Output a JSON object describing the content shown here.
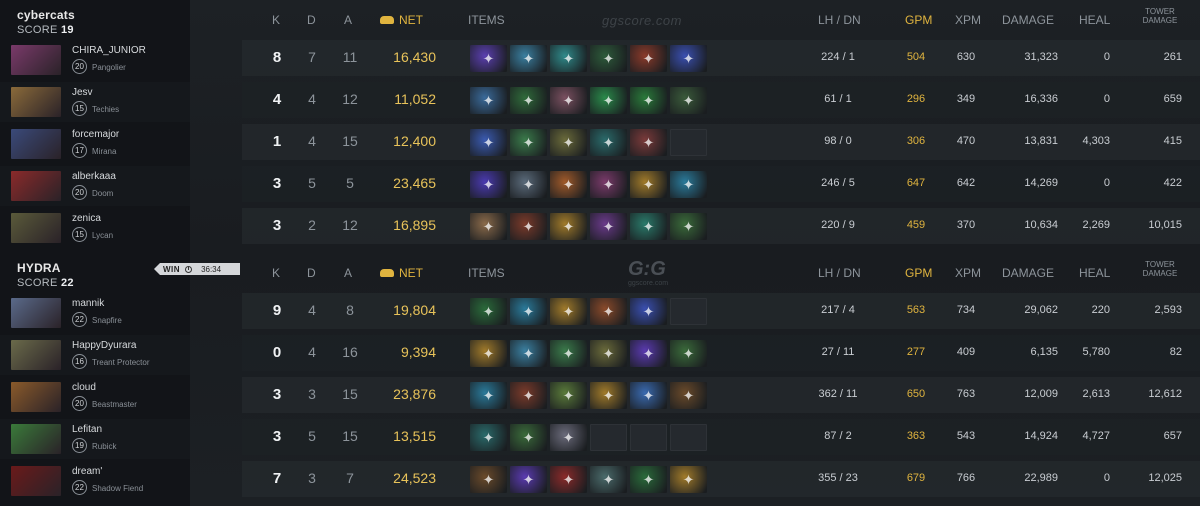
{
  "headers": {
    "k": "K",
    "d": "D",
    "a": "A",
    "net": "NET",
    "items": "ITEMS",
    "lh_dn": "LH / DN",
    "gpm": "GPM",
    "xpm": "XPM",
    "damage": "DAMAGE",
    "heal": "HEAL",
    "tower_damage_1": "TOWER",
    "tower_damage_2": "DAMAGE"
  },
  "watermark_top": "ggscore.com",
  "watermark_mid": "G:G",
  "watermark_mid_sub": "ggscore.com",
  "colors": {
    "gold": "#e0b43f",
    "background": "#16191d"
  },
  "teams": [
    {
      "name": "cybercats",
      "score_label": "SCORE",
      "score": "19",
      "players": [
        {
          "name": "CHIRA_JUNIOR",
          "level": "20",
          "hero": "Pangolier",
          "k": "8",
          "d": "7",
          "a": "11",
          "net": "16,430",
          "items": [
            "#5b3fb0",
            "#3a7fa0",
            "#2f8a8a",
            "#2d5a3a",
            "#8a3a2a",
            "#3a4fb0"
          ],
          "lh_dn": "224 / 1",
          "gpm": "504",
          "xpm": "630",
          "damage": "31,323",
          "heal": "0",
          "tower": "261",
          "avatar": "#7a3a6a"
        },
        {
          "name": "Jesv",
          "level": "15",
          "hero": "Techies",
          "k": "4",
          "d": "4",
          "a": "12",
          "net": "11,052",
          "items": [
            "#3a6a9a",
            "#2f6a3a",
            "#7a5060",
            "#2a8a4a",
            "#2a7a3a",
            "#3a5a3a"
          ],
          "lh_dn": "61 / 1",
          "gpm": "296",
          "xpm": "349",
          "damage": "16,336",
          "heal": "0",
          "tower": "659",
          "avatar": "#8a6a3a"
        },
        {
          "name": "forcemajor",
          "level": "17",
          "hero": "Mirana",
          "k": "1",
          "d": "4",
          "a": "15",
          "net": "12,400",
          "items": [
            "#3a5ab0",
            "#3a7a4a",
            "#6a6a3a",
            "#2a6a6a",
            "#7a3a3a",
            ""
          ],
          "lh_dn": "98 / 0",
          "gpm": "306",
          "xpm": "470",
          "damage": "13,831",
          "heal": "4,303",
          "tower": "415",
          "avatar": "#3a4a7a"
        },
        {
          "name": "alberkaaa",
          "level": "20",
          "hero": "Doom",
          "k": "3",
          "d": "5",
          "a": "5",
          "net": "23,465",
          "items": [
            "#4a3ab0",
            "#5a6a7a",
            "#a05a2a",
            "#7a3a6a",
            "#a07a2a",
            "#2a7a9a"
          ],
          "lh_dn": "246 / 5",
          "gpm": "647",
          "xpm": "642",
          "damage": "14,269",
          "heal": "0",
          "tower": "422",
          "avatar": "#8a2a2a"
        },
        {
          "name": "zenica",
          "level": "15",
          "hero": "Lycan",
          "k": "3",
          "d": "2",
          "a": "12",
          "net": "16,895",
          "items": [
            "#8a6a4a",
            "#7a3a2a",
            "#a07a2a",
            "#6a3a8a",
            "#2a7a6a",
            "#3a6a3a"
          ],
          "lh_dn": "220 / 9",
          "gpm": "459",
          "xpm": "370",
          "damage": "10,634",
          "heal": "2,269",
          "tower": "10,015",
          "avatar": "#5a5a3a"
        }
      ]
    },
    {
      "name": "HYDRA",
      "score_label": "SCORE",
      "score": "22",
      "result": "WIN",
      "duration": "36:34",
      "players": [
        {
          "name": "mannik",
          "level": "22",
          "hero": "Snapfire",
          "k": "9",
          "d": "4",
          "a": "8",
          "net": "19,804",
          "items": [
            "#2a6a3a",
            "#2a7a9a",
            "#a07a2a",
            "#8a4a2a",
            "#3a4fb0",
            ""
          ],
          "lh_dn": "217 / 4",
          "gpm": "563",
          "xpm": "734",
          "damage": "29,062",
          "heal": "220",
          "tower": "2,593",
          "avatar": "#5a6a8a"
        },
        {
          "name": "HappyDyurara",
          "level": "16",
          "hero": "Treant Protector",
          "k": "0",
          "d": "4",
          "a": "16",
          "net": "9,394",
          "items": [
            "#a07a2a",
            "#3a7fa0",
            "#3a7a4a",
            "#6a6a3a",
            "#5a3ab0",
            "#3a6a3a"
          ],
          "lh_dn": "27 / 11",
          "gpm": "277",
          "xpm": "409",
          "damage": "6,135",
          "heal": "5,780",
          "tower": "82",
          "avatar": "#6a6a4a"
        },
        {
          "name": "cloud",
          "level": "20",
          "hero": "Beastmaster",
          "k": "3",
          "d": "3",
          "a": "15",
          "net": "23,876",
          "items": [
            "#2a7a9a",
            "#7a3a2a",
            "#5a7a3a",
            "#a07a2a",
            "#3a6ab0",
            "#6a4a2a"
          ],
          "lh_dn": "362 / 11",
          "gpm": "650",
          "xpm": "763",
          "damage": "12,009",
          "heal": "2,613",
          "tower": "12,612",
          "avatar": "#8a5a2a"
        },
        {
          "name": "Lefitan",
          "level": "19",
          "hero": "Rubick",
          "k": "3",
          "d": "5",
          "a": "15",
          "net": "13,515",
          "items": [
            "#2a6a6a",
            "#3a6a3a",
            "#6a6a7a",
            "",
            "",
            ""
          ],
          "lh_dn": "87 / 2",
          "gpm": "363",
          "xpm": "543",
          "damage": "14,924",
          "heal": "4,727",
          "tower": "657",
          "avatar": "#3a7a3a"
        },
        {
          "name": "dream'",
          "level": "22",
          "hero": "Shadow Fiend",
          "k": "7",
          "d": "3",
          "a": "7",
          "net": "24,523",
          "items": [
            "#6a4a2a",
            "#5a3ab0",
            "#8a2a2a",
            "#4a6a6a",
            "#2a6a3a",
            "#a07a2a"
          ],
          "lh_dn": "355 / 23",
          "gpm": "679",
          "xpm": "766",
          "damage": "22,989",
          "heal": "0",
          "tower": "12,025",
          "avatar": "#6a1a1a"
        }
      ]
    }
  ]
}
